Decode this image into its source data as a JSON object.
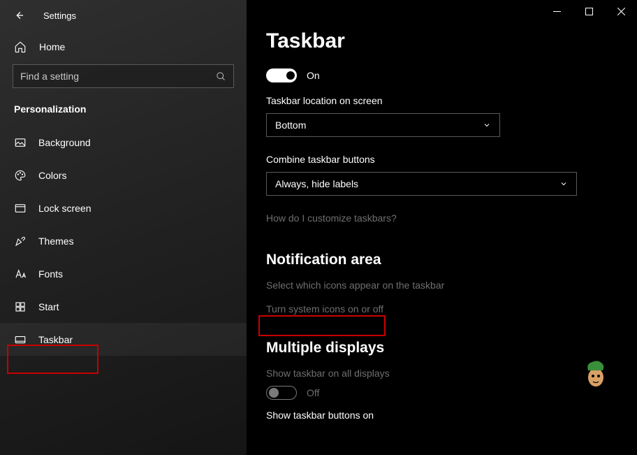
{
  "header": {
    "app_title": "Settings"
  },
  "sidebar": {
    "home_label": "Home",
    "search_placeholder": "Find a setting",
    "category": "Personalization",
    "items": [
      {
        "label": "Background"
      },
      {
        "label": "Colors"
      },
      {
        "label": "Lock screen"
      },
      {
        "label": "Themes"
      },
      {
        "label": "Fonts"
      },
      {
        "label": "Start"
      },
      {
        "label": "Taskbar"
      }
    ]
  },
  "main": {
    "title": "Taskbar",
    "toggle1_label": "On",
    "loc_label": "Taskbar location on screen",
    "loc_value": "Bottom",
    "combine_label": "Combine taskbar buttons",
    "combine_value": "Always, hide labels",
    "help_link": "How do I customize taskbars?",
    "section_notif": "Notification area",
    "notif_link1": "Select which icons appear on the taskbar",
    "notif_link2": "Turn system icons on or off",
    "section_multi": "Multiple displays",
    "multi_label": "Show taskbar on all displays",
    "multi_toggle_label": "Off",
    "multi_buttons_label": "Show taskbar buttons on"
  }
}
